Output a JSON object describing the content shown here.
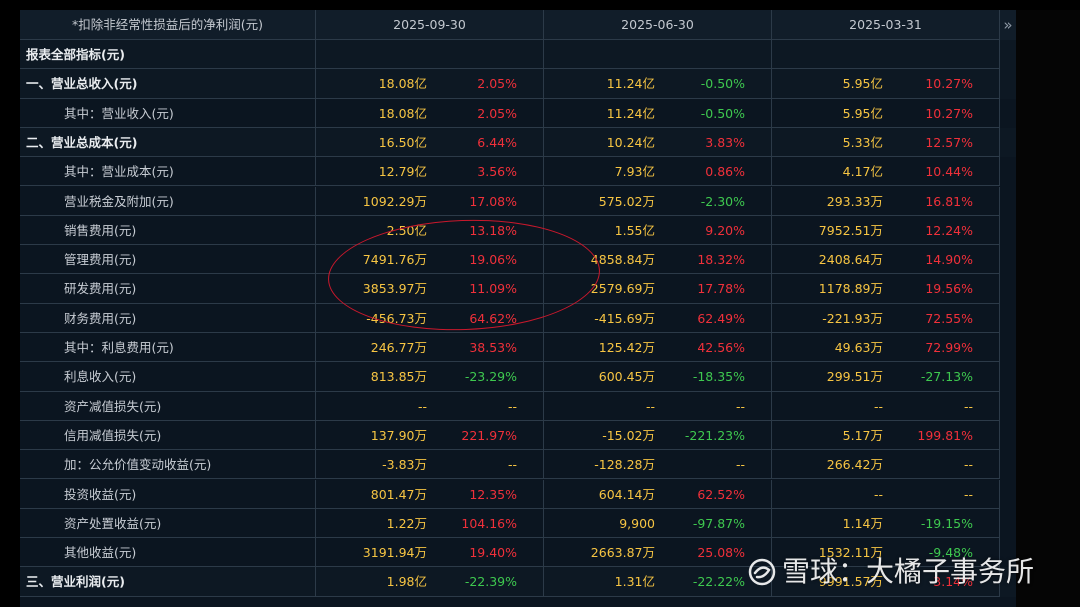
{
  "header": {
    "title": "*扣除非经常性损益后的净利润(元)",
    "periods": [
      "2025-09-30",
      "2025-06-30",
      "2025-03-31"
    ]
  },
  "rows": [
    {
      "label": "报表全部指标(元)",
      "style": "section",
      "cells": []
    },
    {
      "label": "一、营业总收入(元)",
      "style": "section",
      "cells": [
        {
          "v": "18.08亿",
          "p": "2.05%",
          "d": "up"
        },
        {
          "v": "11.24亿",
          "p": "-0.50%",
          "d": "down"
        },
        {
          "v": "5.95亿",
          "p": "10.27%",
          "d": "up"
        }
      ]
    },
    {
      "label": "其中：营业收入(元)",
      "style": "indent",
      "cells": [
        {
          "v": "18.08亿",
          "p": "2.05%",
          "d": "up"
        },
        {
          "v": "11.24亿",
          "p": "-0.50%",
          "d": "down"
        },
        {
          "v": "5.95亿",
          "p": "10.27%",
          "d": "up"
        }
      ]
    },
    {
      "label": "二、营业总成本(元)",
      "style": "section",
      "cells": [
        {
          "v": "16.50亿",
          "p": "6.44%",
          "d": "up"
        },
        {
          "v": "10.24亿",
          "p": "3.83%",
          "d": "up"
        },
        {
          "v": "5.33亿",
          "p": "12.57%",
          "d": "up"
        }
      ]
    },
    {
      "label": "其中：营业成本(元)",
      "style": "indent",
      "cells": [
        {
          "v": "12.79亿",
          "p": "3.56%",
          "d": "up"
        },
        {
          "v": "7.93亿",
          "p": "0.86%",
          "d": "up"
        },
        {
          "v": "4.17亿",
          "p": "10.44%",
          "d": "up"
        }
      ]
    },
    {
      "label": "营业税金及附加(元)",
      "style": "indent",
      "cells": [
        {
          "v": "1092.29万",
          "p": "17.08%",
          "d": "up"
        },
        {
          "v": "575.02万",
          "p": "-2.30%",
          "d": "down"
        },
        {
          "v": "293.33万",
          "p": "16.81%",
          "d": "up"
        }
      ]
    },
    {
      "label": "销售费用(元)",
      "style": "indent",
      "cells": [
        {
          "v": "2.50亿",
          "p": "13.18%",
          "d": "up"
        },
        {
          "v": "1.55亿",
          "p": "9.20%",
          "d": "up"
        },
        {
          "v": "7952.51万",
          "p": "12.24%",
          "d": "up"
        }
      ]
    },
    {
      "label": "管理费用(元)",
      "style": "indent",
      "cells": [
        {
          "v": "7491.76万",
          "p": "19.06%",
          "d": "up"
        },
        {
          "v": "4858.84万",
          "p": "18.32%",
          "d": "up"
        },
        {
          "v": "2408.64万",
          "p": "14.90%",
          "d": "up"
        }
      ]
    },
    {
      "label": "研发费用(元)",
      "style": "indent",
      "cells": [
        {
          "v": "3853.97万",
          "p": "11.09%",
          "d": "up"
        },
        {
          "v": "2579.69万",
          "p": "17.78%",
          "d": "up"
        },
        {
          "v": "1178.89万",
          "p": "19.56%",
          "d": "up"
        }
      ]
    },
    {
      "label": "财务费用(元)",
      "style": "indent",
      "cells": [
        {
          "v": "-456.73万",
          "p": "64.62%",
          "d": "up"
        },
        {
          "v": "-415.69万",
          "p": "62.49%",
          "d": "up"
        },
        {
          "v": "-221.93万",
          "p": "72.55%",
          "d": "up"
        }
      ]
    },
    {
      "label": "其中：利息费用(元)",
      "style": "indent",
      "cells": [
        {
          "v": "246.77万",
          "p": "38.53%",
          "d": "up"
        },
        {
          "v": "125.42万",
          "p": "42.56%",
          "d": "up"
        },
        {
          "v": "49.63万",
          "p": "72.99%",
          "d": "up"
        }
      ]
    },
    {
      "label": "利息收入(元)",
      "style": "indent",
      "cells": [
        {
          "v": "813.85万",
          "p": "-23.29%",
          "d": "down"
        },
        {
          "v": "600.45万",
          "p": "-18.35%",
          "d": "down"
        },
        {
          "v": "299.51万",
          "p": "-27.13%",
          "d": "down"
        }
      ]
    },
    {
      "label": "资产减值损失(元)",
      "style": "indent",
      "cells": [
        {
          "v": "--",
          "p": "--",
          "d": "neutral"
        },
        {
          "v": "--",
          "p": "--",
          "d": "neutral"
        },
        {
          "v": "--",
          "p": "--",
          "d": "neutral"
        }
      ]
    },
    {
      "label": "信用减值损失(元)",
      "style": "indent",
      "cells": [
        {
          "v": "137.90万",
          "p": "221.97%",
          "d": "up"
        },
        {
          "v": "-15.02万",
          "p": "-221.23%",
          "d": "down"
        },
        {
          "v": "5.17万",
          "p": "199.81%",
          "d": "up"
        }
      ]
    },
    {
      "label": "加：公允价值变动收益(元)",
      "style": "indent",
      "cells": [
        {
          "v": "-3.83万",
          "p": "--",
          "d": "neutral"
        },
        {
          "v": "-128.28万",
          "p": "--",
          "d": "neutral"
        },
        {
          "v": "266.42万",
          "p": "--",
          "d": "neutral"
        }
      ]
    },
    {
      "label": "投资收益(元)",
      "style": "indent",
      "cells": [
        {
          "v": "801.47万",
          "p": "12.35%",
          "d": "up"
        },
        {
          "v": "604.14万",
          "p": "62.52%",
          "d": "up"
        },
        {
          "v": "--",
          "p": "--",
          "d": "neutral"
        }
      ]
    },
    {
      "label": "资产处置收益(元)",
      "style": "indent",
      "cells": [
        {
          "v": "1.22万",
          "p": "104.16%",
          "d": "up"
        },
        {
          "v": "9,900",
          "p": "-97.87%",
          "d": "down"
        },
        {
          "v": "1.14万",
          "p": "-19.15%",
          "d": "down"
        }
      ]
    },
    {
      "label": "其他收益(元)",
      "style": "indent",
      "cells": [
        {
          "v": "3191.94万",
          "p": "19.40%",
          "d": "up"
        },
        {
          "v": "2663.87万",
          "p": "25.08%",
          "d": "up"
        },
        {
          "v": "1532.11万",
          "p": "-9.48%",
          "d": "down"
        }
      ]
    },
    {
      "label": "三、营业利润(元)",
      "style": "section",
      "cells": [
        {
          "v": "1.98亿",
          "p": "-22.39%",
          "d": "down"
        },
        {
          "v": "1.31亿",
          "p": "-22.22%",
          "d": "down"
        },
        {
          "v": "9991.57万",
          "p": "3.14%",
          "d": "up"
        }
      ]
    }
  ],
  "watermark": {
    "text": "雪球：大橘子事务所"
  },
  "colors": {
    "background": "#0b1520",
    "value": "#f7c543",
    "up": "#f0303a",
    "down": "#3ec84f",
    "annotation": "#c9182c"
  },
  "icons": {
    "more": "double-chevron-right-icon",
    "watermark_logo": "snowball-logo-icon"
  }
}
